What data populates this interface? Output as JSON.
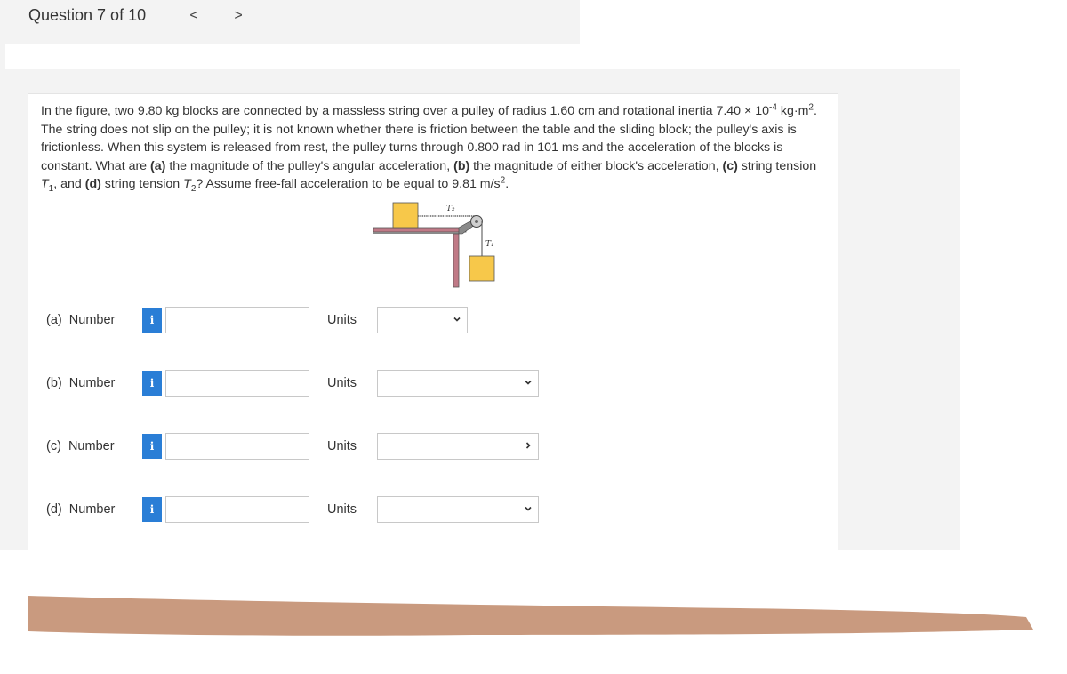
{
  "header": {
    "question_counter": "Question 7 of 10",
    "prev_glyph": "<",
    "next_glyph": ">"
  },
  "question": {
    "text_html": "In the figure, two 9.80 kg blocks are connected by a massless string over a pulley of radius 1.60 cm and rotational inertia 7.40 × 10<sup>-4</sup> kg·m<sup>2</sup>. The string does not slip on the pulley; it is not known whether there is friction between the table and the sliding block; the pulley's axis is frictionless. When this system is released from rest, the pulley turns through 0.800 rad in 101 ms and the acceleration of the blocks is constant. What are <b>(a)</b> the magnitude of the pulley's angular acceleration, <b>(b)</b> the magnitude of either block's acceleration, <b>(c)</b> string tension <i>T</i><sub>1</sub>, and <b>(d)</b> string tension <i>T</i><sub>2</sub>? Assume free-fall acceleration to be equal to 9.81 m/s<sup>2</sup>."
  },
  "figure": {
    "label_t2": "T₂",
    "label_t1": "T₁",
    "block_color": "#f7c84a"
  },
  "answers": [
    {
      "label": "(a)  Number",
      "info": "i",
      "value": "",
      "units_label": "Units",
      "units_value": ""
    },
    {
      "label": "(b)  Number",
      "info": "i",
      "value": "",
      "units_label": "Units",
      "units_value": ""
    },
    {
      "label": "(c)  Number",
      "info": "i",
      "value": "",
      "units_label": "Units",
      "units_value": ""
    },
    {
      "label": "(d)  Number",
      "info": "i",
      "value": "",
      "units_label": "Units",
      "units_value": ""
    }
  ],
  "colors": {
    "info_blue": "#2a7ed6",
    "redaction_bar": "#c99a7f"
  }
}
